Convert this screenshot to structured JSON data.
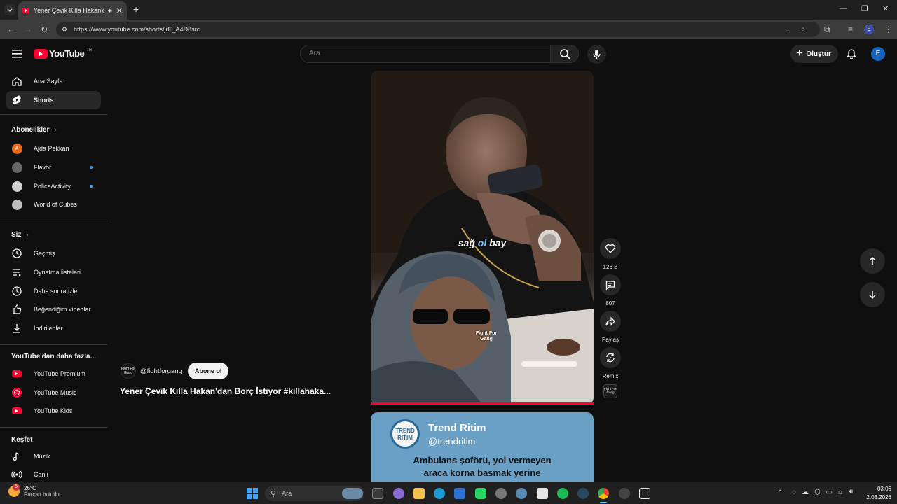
{
  "browser": {
    "tab_title": "Yener Çevik Killa Hakan'dan",
    "url": "https://www.youtube.com/shorts/jrE_A4D8src",
    "profile_letter": "E"
  },
  "youtube": {
    "logo_text": "YouTube",
    "region": "TR",
    "search_placeholder": "Ara",
    "create_label": "Oluştur",
    "avatar_letter": "E"
  },
  "sidebar": {
    "main": [
      {
        "label": "Ana Sayfa",
        "icon": "home-icon"
      },
      {
        "label": "Shorts",
        "icon": "shorts-icon",
        "active": true
      }
    ],
    "subscriptions_title": "Abonelikler",
    "subscriptions": [
      {
        "label": "Ajda Pekkan",
        "badge": "A",
        "color": "#e8691e",
        "new": false
      },
      {
        "label": "Flavor",
        "color": "#666666",
        "new": true
      },
      {
        "label": "PoliceActivity",
        "color": "#cfcfcf",
        "new": true
      },
      {
        "label": "World of Cubes",
        "color": "#bdbdbd",
        "new": false
      }
    ],
    "you_title": "Siz",
    "you_items": [
      {
        "label": "Geçmiş",
        "icon": "history-icon"
      },
      {
        "label": "Oynatma listeleri",
        "icon": "playlists-icon"
      },
      {
        "label": "Daha sonra izle",
        "icon": "watch-later-icon"
      },
      {
        "label": "Beğendiğim videolar",
        "icon": "liked-videos-icon"
      },
      {
        "label": "İndirilenler",
        "icon": "downloads-icon"
      }
    ],
    "more_title": "YouTube'dan daha fazla...",
    "more_items": [
      {
        "label": "YouTube Premium"
      },
      {
        "label": "YouTube Music"
      },
      {
        "label": "YouTube Kids"
      }
    ],
    "explore_title": "Keşfet",
    "explore_items": [
      {
        "label": "Müzik",
        "icon": "music-icon"
      },
      {
        "label": "Canlı",
        "icon": "live-icon"
      }
    ]
  },
  "short": {
    "channel_handle": "@fightforgang",
    "subscribe_label": "Abone ol",
    "title": "Yener Çevik Killa Hakan'dan Borç İstiyor #killahaka...",
    "caption_parts": [
      "sağ ",
      "ol",
      " bay"
    ],
    "watermark": "Fight For Gang",
    "progress": 1.0,
    "actions": {
      "like_count": "126 B",
      "comment_count": "807",
      "share_label": "Paylaş",
      "remix_label": "Remix"
    }
  },
  "next_short": {
    "logo_line1": "TREND",
    "logo_line2": "RİTİM",
    "channel_name": "Trend Ritim",
    "channel_handle": "@trendritim",
    "headline_line1": "Ambulans şoförü, yol vermeyen",
    "headline_line2": "araca korna basmak yerine"
  },
  "taskbar": {
    "weather_temp": "26°C",
    "weather_desc": "Parçalı bulutlu",
    "weather_badge": "5",
    "search_placeholder": "Ara",
    "time": "03:06",
    "date": "2.08.2026"
  }
}
